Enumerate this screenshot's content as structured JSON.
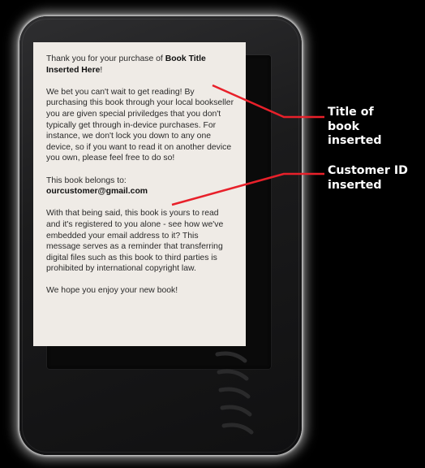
{
  "screen": {
    "greeting_prefix": "Thank you for your purchase of ",
    "book_title": "Book Title Inserted Here",
    "greeting_suffix": "!",
    "paragraph_1": "We bet you can't wait to get reading! By purchasing this book through your local bookseller you are given special priviledges that you don't typically get through in-device purchases. For instance, we don't lock you down to any one device, so if you want to read it on another device you own, please feel free to do so!",
    "belongs_label": "This book belongs to:",
    "customer_email": "ourcustomer@gmail.com",
    "paragraph_2": "With that being said, this book is yours to read and it's registered to you alone - see how we've embedded your email address to it? This message serves as a reminder that transferring digital files such as this book to third parties is prohibited by international copyright law.",
    "closing": "We hope you enjoy your new book!"
  },
  "annotations": {
    "title_callout": "Title of book inserted",
    "customer_callout": "Customer ID inserted",
    "line_color": "#e8202a"
  },
  "colors": {
    "page_background": "#000000",
    "screen_background": "#efebe6",
    "device_body": "#1b1b1c"
  }
}
